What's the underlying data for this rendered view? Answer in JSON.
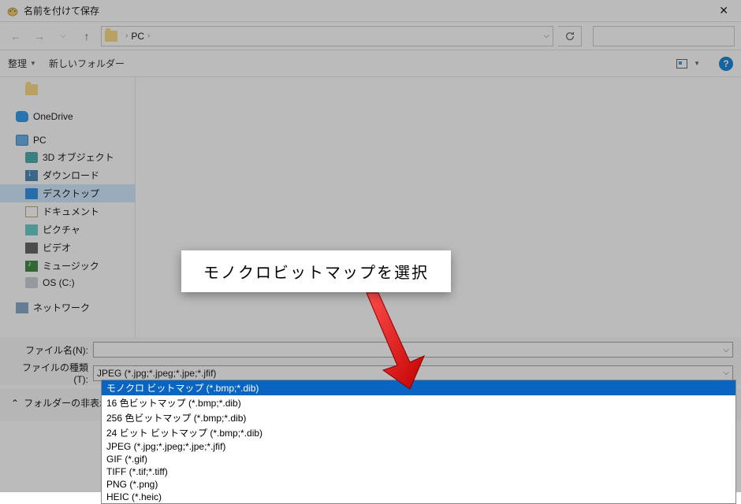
{
  "window": {
    "title": "名前を付けて保存"
  },
  "address": {
    "path": "PC"
  },
  "toolbar": {
    "organize": "整理",
    "new_folder": "新しいフォルダー"
  },
  "sidebar": {
    "onedrive": "OneDrive",
    "pc": "PC",
    "objects3d": "3D オブジェクト",
    "downloads": "ダウンロード",
    "desktop": "デスクトップ",
    "documents": "ドキュメント",
    "pictures": "ピクチャ",
    "videos": "ビデオ",
    "music": "ミュージック",
    "disk_c": "OS (C:)",
    "network": "ネットワーク"
  },
  "fields": {
    "filename_label": "ファイル名(N):",
    "filename_value": "",
    "filetype_label": "ファイルの種類(T):",
    "filetype_value": "JPEG (*.jpg;*.jpeg;*.jpe;*.jfif)"
  },
  "bottom": {
    "hide_folders": "フォルダーの非表示"
  },
  "dropdown": {
    "items": [
      "モノクロ ビットマップ (*.bmp;*.dib)",
      "16 色ビットマップ (*.bmp;*.dib)",
      "256 色ビットマップ (*.bmp;*.dib)",
      "24 ビット ビットマップ (*.bmp;*.dib)",
      "JPEG (*.jpg;*.jpeg;*.jpe;*.jfif)",
      "GIF (*.gif)",
      "TIFF (*.tif;*.tiff)",
      "PNG (*.png)",
      "HEIC (*.heic)"
    ],
    "selected_index": 0
  },
  "callout": {
    "text": "モノクロビットマップを選択"
  }
}
